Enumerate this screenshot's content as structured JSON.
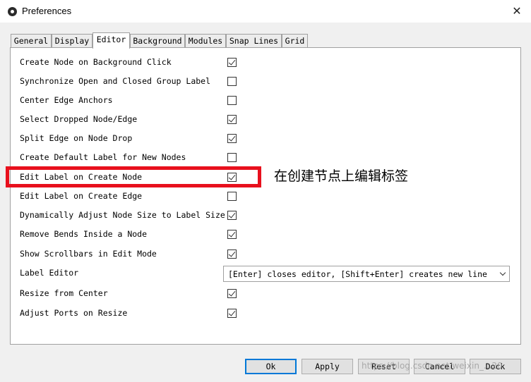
{
  "window": {
    "title": "Preferences"
  },
  "tabs": [
    {
      "label": "General",
      "active": false
    },
    {
      "label": "Display",
      "active": false
    },
    {
      "label": "Editor",
      "active": true
    },
    {
      "label": "Background",
      "active": false
    },
    {
      "label": "Modules",
      "active": false
    },
    {
      "label": "Snap Lines",
      "active": false
    },
    {
      "label": "Grid",
      "active": false
    }
  ],
  "options": [
    {
      "label": "Create Node on Background Click",
      "checked": true
    },
    {
      "label": "Synchronize Open and Closed Group Label",
      "checked": false
    },
    {
      "label": "Center Edge Anchors",
      "checked": false
    },
    {
      "label": "Select Dropped Node/Edge",
      "checked": true
    },
    {
      "label": "Split Edge on Node Drop",
      "checked": true
    },
    {
      "label": "Create Default Label for New Nodes",
      "checked": false
    },
    {
      "label": "Edit Label on Create Node",
      "checked": true
    },
    {
      "label": "Edit Label on Create Edge",
      "checked": false
    },
    {
      "label": "Dynamically Adjust Node Size to Label Size",
      "checked": true
    },
    {
      "label": "Remove Bends Inside a Node",
      "checked": true
    },
    {
      "label": "Show Scrollbars in Edit Mode",
      "checked": true
    }
  ],
  "label_editor": {
    "label": "Label Editor",
    "value": "[Enter] closes editor, [Shift+Enter] creates new line"
  },
  "options_after": [
    {
      "label": "Resize from Center",
      "checked": true
    },
    {
      "label": "Adjust Ports on Resize",
      "checked": true
    }
  ],
  "annotation": {
    "text": "在创建节点上编辑标签",
    "color": "#e8101d"
  },
  "buttons": {
    "ok": "Ok",
    "apply": "Apply",
    "reset": "Reset",
    "cancel": "Cancel",
    "dock": "Dock"
  },
  "watermark": "https://blog.csdn.net/weixin_...20",
  "colors": {
    "highlight": "#e8101d",
    "primary_border": "#0078d7"
  }
}
